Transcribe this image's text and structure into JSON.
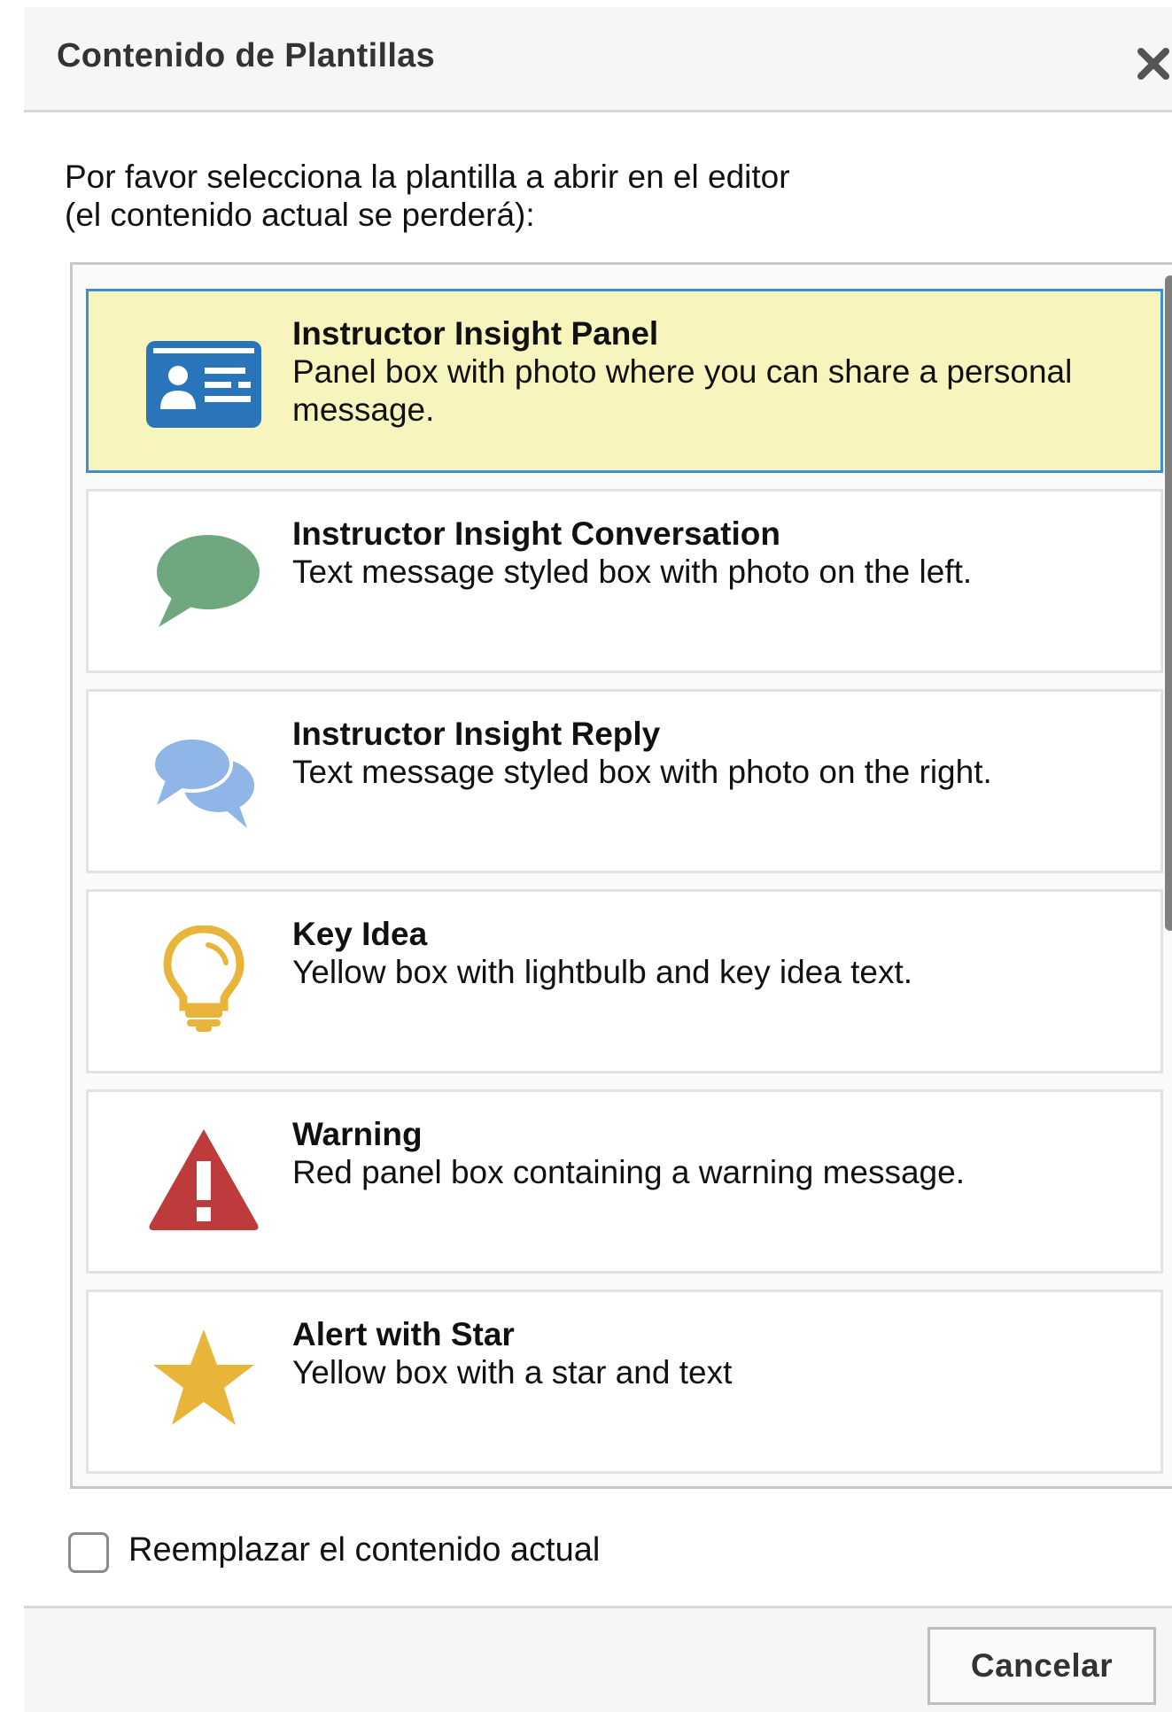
{
  "dialog": {
    "title": "Contenido de Plantillas",
    "intro_line1": "Por favor selecciona la plantilla a abrir en el editor",
    "intro_line2": "(el contenido actual se perderá):",
    "templates": [
      {
        "name": "Instructor Insight Panel",
        "description": "Panel box with photo where you can share a personal message.",
        "icon": "id-card-icon",
        "selected": true
      },
      {
        "name": "Instructor Insight Conversation",
        "description": "Text message styled box with photo on the left.",
        "icon": "speech-bubble-icon",
        "selected": false
      },
      {
        "name": "Instructor Insight Reply",
        "description": "Text message styled box with photo on the right.",
        "icon": "chat-bubbles-icon",
        "selected": false
      },
      {
        "name": "Key Idea",
        "description": "Yellow box with lightbulb and key idea text.",
        "icon": "lightbulb-icon",
        "selected": false
      },
      {
        "name": "Warning",
        "description": "Red panel box containing a warning message.",
        "icon": "warning-icon",
        "selected": false
      },
      {
        "name": "Alert with Star",
        "description": "Yellow box with a star and text",
        "icon": "star-icon",
        "selected": false
      }
    ],
    "replace_checkbox_label": "Reemplazar el contenido actual",
    "replace_checked": false,
    "cancel_label": "Cancelar"
  },
  "colors": {
    "selected_bg": "#f8f4bd",
    "selected_border": "#3d8fd1",
    "id_card": "#2a75b9",
    "speech_green": "#6fa87e",
    "chat_blue": "#8fb6e6",
    "bulb_yellow": "#e8b53a",
    "warning_red": "#bd3b3b",
    "star_yellow": "#e8b53a"
  }
}
